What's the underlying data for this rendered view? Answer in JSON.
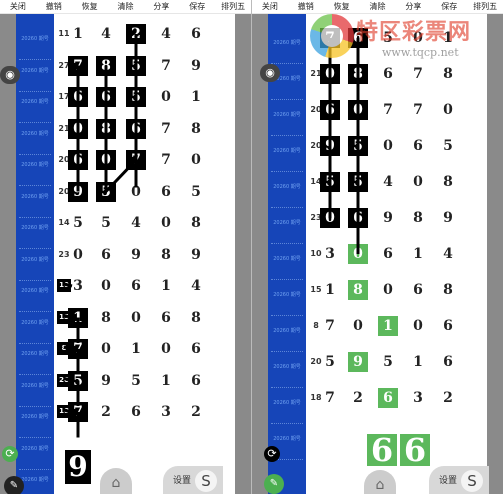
{
  "menu": [
    "关闭",
    "撤销",
    "恢复",
    "清除",
    "分享",
    "保存",
    "排列五"
  ],
  "period_code": "20260\n期号",
  "left": {
    "sums": [
      "11",
      "27",
      "17",
      "21",
      "20",
      "20",
      "14",
      "23",
      "",
      "",
      "",
      "",
      "",
      ""
    ],
    "rows": [
      [
        "1",
        "4",
        "2",
        "4",
        "6"
      ],
      [
        "7",
        "8",
        "5",
        "7",
        "9"
      ],
      [
        "6",
        "6",
        "5",
        "0",
        "1"
      ],
      [
        "0",
        "8",
        "6",
        "7",
        "8"
      ],
      [
        "6",
        "0",
        "7",
        "7",
        "0"
      ],
      [
        "9",
        "5",
        "0",
        "6",
        "5"
      ],
      [
        "5",
        "5",
        "4",
        "0",
        "8"
      ],
      [
        "0",
        "6",
        "9",
        "8",
        "9"
      ],
      [
        "3",
        "0",
        "6",
        "1",
        "4"
      ],
      [
        "1",
        "8",
        "0",
        "6",
        "8"
      ],
      [
        "7",
        "0",
        "1",
        "0",
        "6"
      ],
      [
        "5",
        "9",
        "5",
        "1",
        "6"
      ],
      [
        "7",
        "2",
        "6",
        "3",
        "2"
      ]
    ],
    "tags": [
      "10",
      "15",
      "8",
      "20",
      "18"
    ],
    "bottom_digit": "9"
  },
  "right": {
    "sums": [
      "",
      "21",
      "20",
      "20",
      "14",
      "23",
      "10",
      "15",
      "8",
      "20",
      "18"
    ],
    "rows": [
      [
        "7",
        "6",
        "5",
        "0",
        "1"
      ],
      [
        "0",
        "8",
        "6",
        "7",
        "8"
      ],
      [
        "6",
        "0",
        "7",
        "7",
        "0"
      ],
      [
        "9",
        "5",
        "0",
        "6",
        "5"
      ],
      [
        "5",
        "5",
        "4",
        "0",
        "8"
      ],
      [
        "0",
        "6",
        "9",
        "8",
        "9"
      ],
      [
        "3",
        "0",
        "6",
        "1",
        "4"
      ],
      [
        "1",
        "8",
        "0",
        "6",
        "8"
      ],
      [
        "7",
        "0",
        "1",
        "0",
        "6"
      ],
      [
        "5",
        "9",
        "5",
        "1",
        "6"
      ],
      [
        "7",
        "2",
        "6",
        "3",
        "2"
      ]
    ],
    "bottom_digits": [
      "6",
      "6"
    ]
  },
  "watermark": {
    "name": "特区彩票网",
    "url": "www.tqcp.net"
  },
  "settings_label": "设置",
  "s_button": "S",
  "colors": {
    "column_blue": "#1645b8",
    "highlight_green": "#5cb85c",
    "box_black": "#000000",
    "side_gray": "#8a8a8a"
  },
  "icons": {
    "eye": "eye-icon",
    "refresh": "refresh-icon",
    "pen": "pen-icon",
    "lock": "lock-icon"
  }
}
